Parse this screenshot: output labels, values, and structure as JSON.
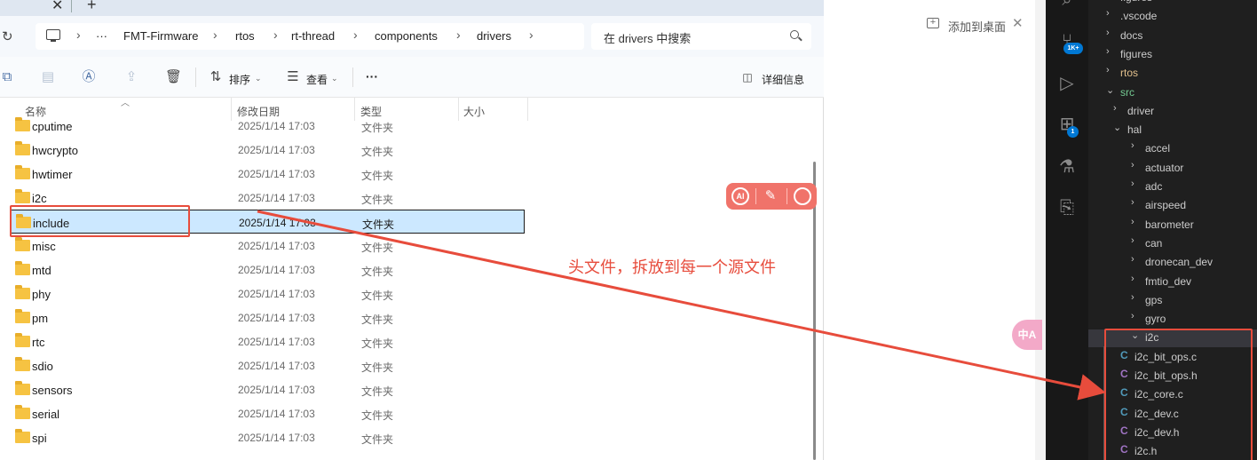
{
  "explorer": {
    "tab_close": "✕",
    "tab_new": "+",
    "breadcrumb": {
      "overflow": "···",
      "items": [
        "FMT-Firmware",
        "rtos",
        "rt-thread",
        "components",
        "drivers"
      ]
    },
    "search_placeholder": "在 drivers 中搜索",
    "toolbar": {
      "sort_label": "排序",
      "view_label": "查看",
      "more_label": "···",
      "details_label": "详细信息"
    },
    "columns": {
      "name": "名称",
      "modified": "修改日期",
      "type": "类型",
      "size": "大小"
    },
    "rows": [
      {
        "name": "cputime",
        "date": "2025/1/14 17:03",
        "type": "文件夹"
      },
      {
        "name": "hwcrypto",
        "date": "2025/1/14 17:03",
        "type": "文件夹"
      },
      {
        "name": "hwtimer",
        "date": "2025/1/14 17:03",
        "type": "文件夹"
      },
      {
        "name": "i2c",
        "date": "2025/1/14 17:03",
        "type": "文件夹"
      },
      {
        "name": "include",
        "date": "2025/1/14 17:03",
        "type": "文件夹"
      },
      {
        "name": "misc",
        "date": "2025/1/14 17:03",
        "type": "文件夹"
      },
      {
        "name": "mtd",
        "date": "2025/1/14 17:03",
        "type": "文件夹"
      },
      {
        "name": "phy",
        "date": "2025/1/14 17:03",
        "type": "文件夹"
      },
      {
        "name": "pm",
        "date": "2025/1/14 17:03",
        "type": "文件夹"
      },
      {
        "name": "rtc",
        "date": "2025/1/14 17:03",
        "type": "文件夹"
      },
      {
        "name": "sdio",
        "date": "2025/1/14 17:03",
        "type": "文件夹"
      },
      {
        "name": "sensors",
        "date": "2025/1/14 17:03",
        "type": "文件夹"
      },
      {
        "name": "serial",
        "date": "2025/1/14 17:03",
        "type": "文件夹"
      },
      {
        "name": "spi",
        "date": "2025/1/14 17:03",
        "type": "文件夹"
      },
      {
        "name": "",
        "date": "",
        "type": ""
      }
    ]
  },
  "middle": {
    "pin_label": "添加到桌面",
    "pin_close": "✕",
    "ai_toolbar": {
      "ai": "AI",
      "edit": "✎",
      "search": ""
    },
    "translate": "中A"
  },
  "annotation": {
    "text": "头文件，拆放到每一个源文件",
    "color": "#e74c3c"
  },
  "vscode": {
    "badges": {
      "source_control": "1K+",
      "extensions": "1"
    },
    "tree": [
      {
        "label": "figures",
        "kind": "folder",
        "depth": 0,
        "expanded": false,
        "status": ""
      },
      {
        "label": ".vscode",
        "kind": "folder",
        "depth": 0,
        "expanded": false,
        "status": ""
      },
      {
        "label": "docs",
        "kind": "folder",
        "depth": 0,
        "expanded": false,
        "status": ""
      },
      {
        "label": "figures",
        "kind": "folder",
        "depth": 0,
        "expanded": false,
        "status": ""
      },
      {
        "label": "rtos",
        "kind": "folder",
        "depth": 0,
        "expanded": false,
        "status": "modified"
      },
      {
        "label": "src",
        "kind": "folder",
        "depth": 0,
        "expanded": true,
        "status": "git"
      },
      {
        "label": "driver",
        "kind": "folder",
        "depth": 1,
        "expanded": false,
        "status": ""
      },
      {
        "label": "hal",
        "kind": "folder",
        "depth": 1,
        "expanded": true,
        "status": ""
      },
      {
        "label": "accel",
        "kind": "folder",
        "depth": 2,
        "expanded": false,
        "status": ""
      },
      {
        "label": "actuator",
        "kind": "folder",
        "depth": 2,
        "expanded": false,
        "status": ""
      },
      {
        "label": "adc",
        "kind": "folder",
        "depth": 2,
        "expanded": false,
        "status": ""
      },
      {
        "label": "airspeed",
        "kind": "folder",
        "depth": 2,
        "expanded": false,
        "status": ""
      },
      {
        "label": "barometer",
        "kind": "folder",
        "depth": 2,
        "expanded": false,
        "status": ""
      },
      {
        "label": "can",
        "kind": "folder",
        "depth": 2,
        "expanded": false,
        "status": ""
      },
      {
        "label": "dronecan_dev",
        "kind": "folder",
        "depth": 2,
        "expanded": false,
        "status": ""
      },
      {
        "label": "fmtio_dev",
        "kind": "folder",
        "depth": 2,
        "expanded": false,
        "status": ""
      },
      {
        "label": "gps",
        "kind": "folder",
        "depth": 2,
        "expanded": false,
        "status": ""
      },
      {
        "label": "gyro",
        "kind": "folder",
        "depth": 2,
        "expanded": false,
        "status": ""
      },
      {
        "label": "i2c",
        "kind": "folder",
        "depth": 2,
        "expanded": true,
        "status": ""
      },
      {
        "label": "i2c_bit_ops.c",
        "kind": "c",
        "depth": 3,
        "status": ""
      },
      {
        "label": "i2c_bit_ops.h",
        "kind": "h",
        "depth": 3,
        "status": ""
      },
      {
        "label": "i2c_core.c",
        "kind": "c",
        "depth": 3,
        "status": ""
      },
      {
        "label": "i2c_dev.c",
        "kind": "c",
        "depth": 3,
        "status": ""
      },
      {
        "label": "i2c_dev.h",
        "kind": "h",
        "depth": 3,
        "status": ""
      },
      {
        "label": "i2c.h",
        "kind": "h",
        "depth": 3,
        "status": ""
      }
    ]
  }
}
